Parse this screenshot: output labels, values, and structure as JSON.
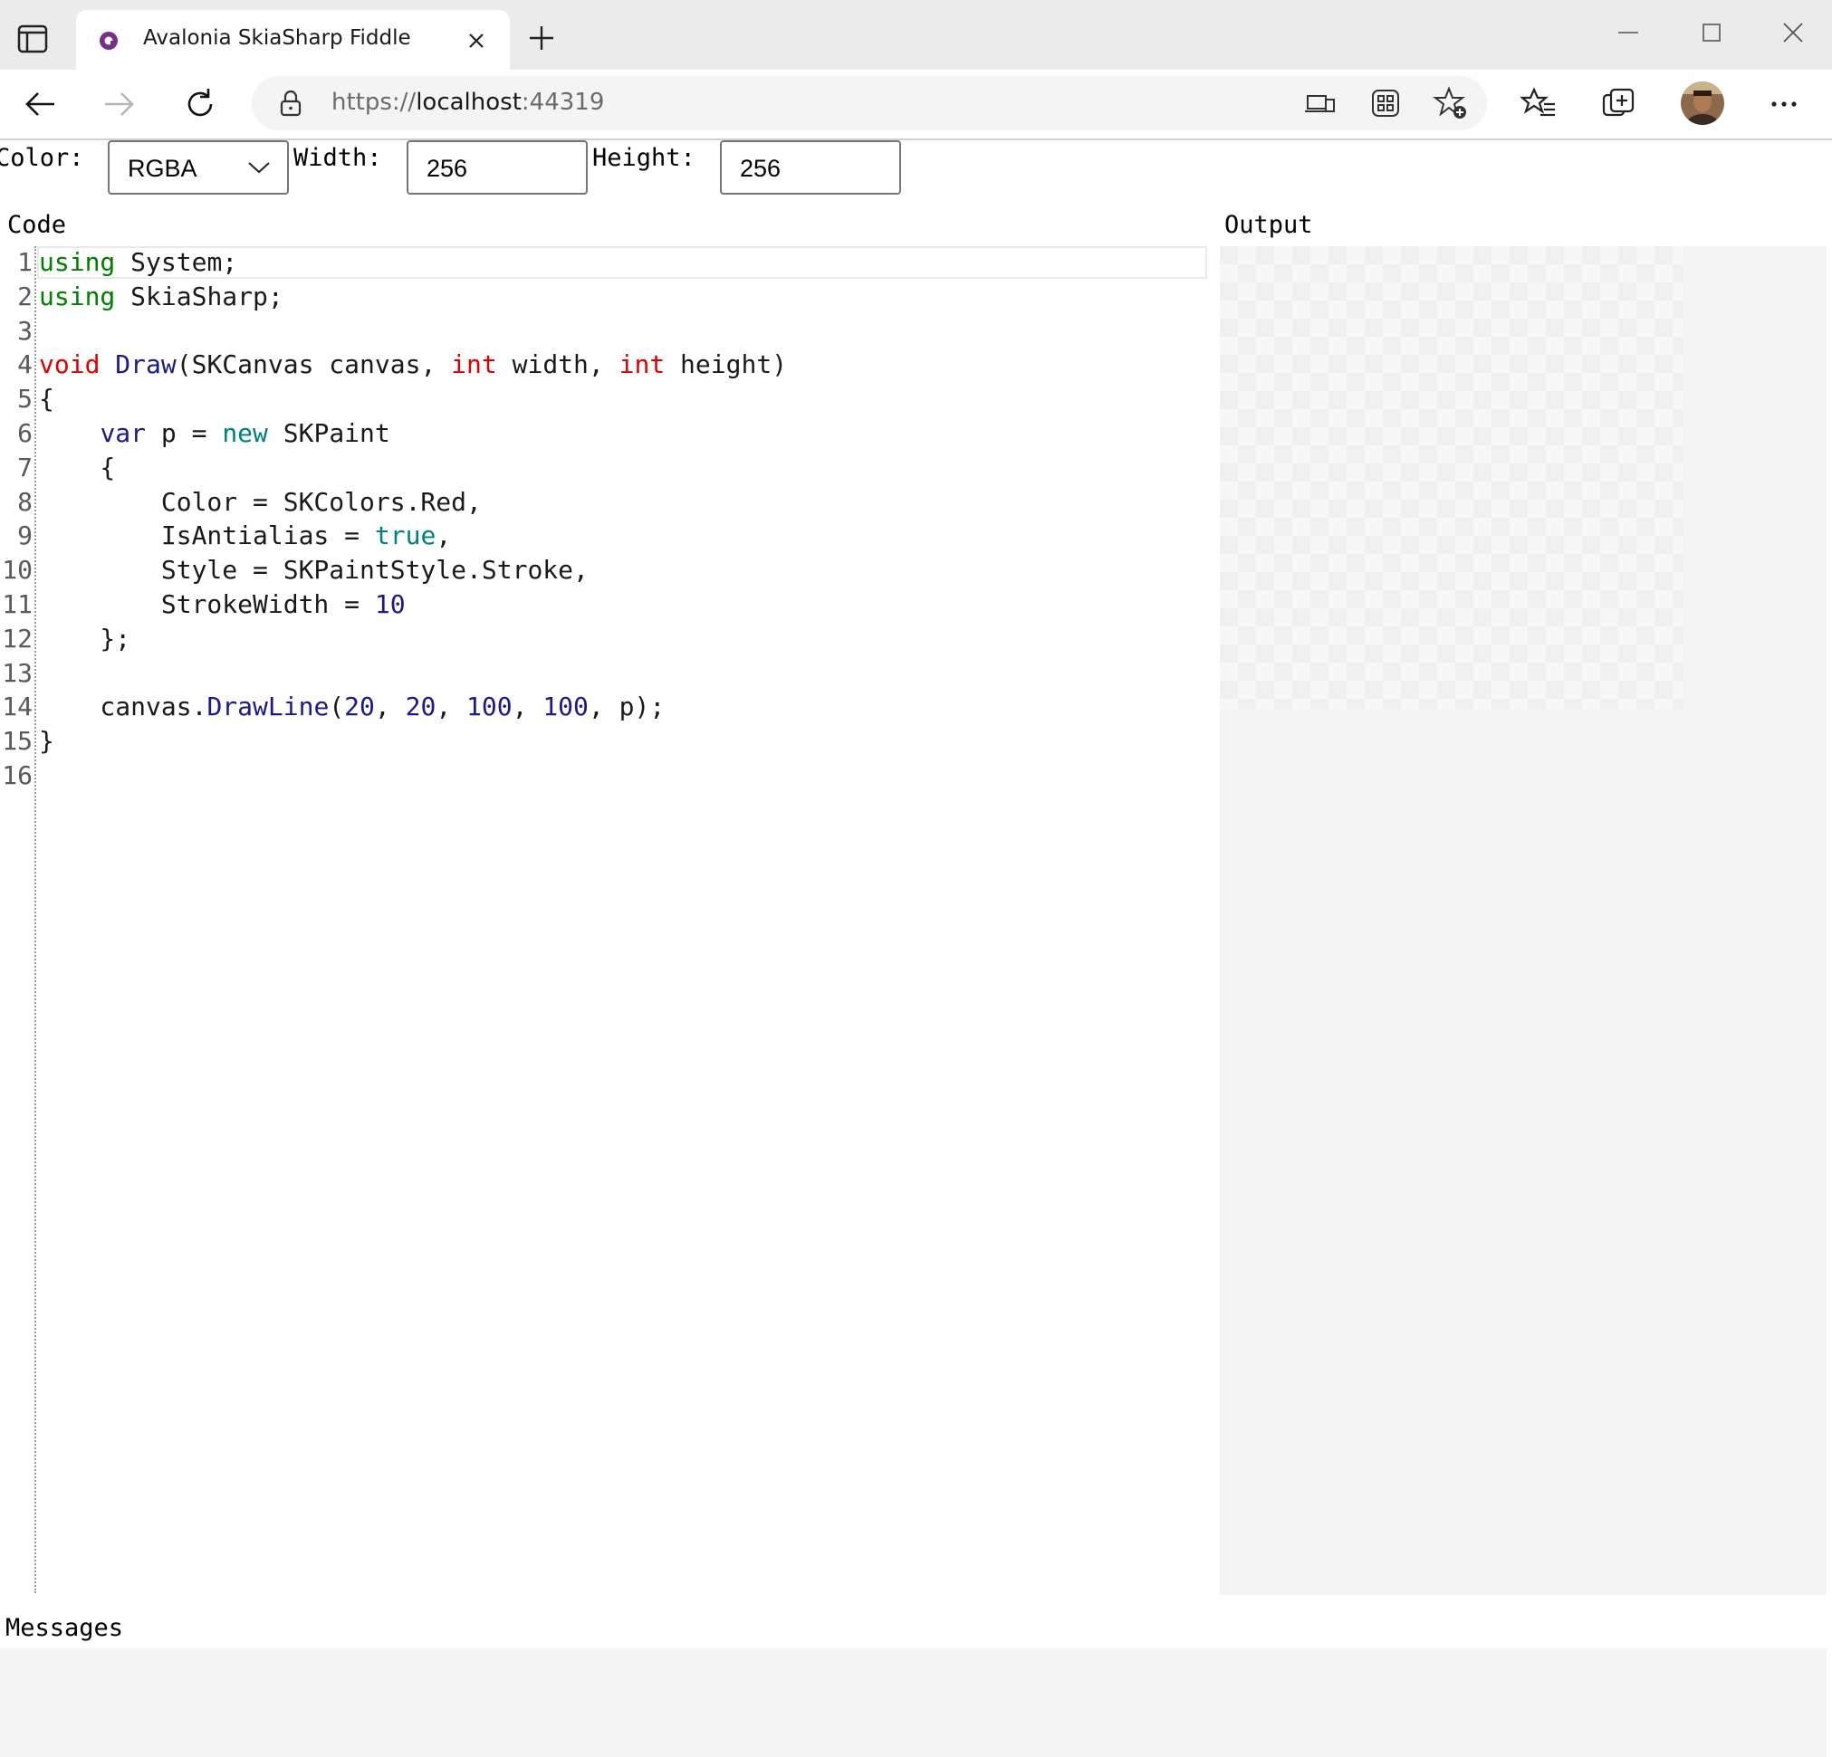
{
  "browser": {
    "tab_title": "Avalonia SkiaSharp Fiddle",
    "url_scheme": "https://",
    "url_host": "localhost",
    "url_port": ":44319",
    "accent": "#7b2d8e"
  },
  "controls": {
    "color_label": "Color:",
    "color_value": "RGBA",
    "width_label": "Width:",
    "width_value": "256",
    "height_label": "Height:",
    "height_value": "256"
  },
  "sections": {
    "code": "Code",
    "output": "Output",
    "messages": "Messages"
  },
  "code_lines": [
    {
      "n": "1",
      "tokens": [
        [
          "kw-green",
          "using"
        ],
        [
          "",
          "System;"
        ]
      ]
    },
    {
      "n": "2",
      "tokens": [
        [
          "kw-green",
          "using"
        ],
        [
          "",
          "SkiaSharp;"
        ]
      ]
    },
    {
      "n": "3",
      "tokens": []
    },
    {
      "n": "4",
      "tokens": [
        [
          "kw-red",
          "void"
        ],
        [
          "kw-blue",
          "Draw"
        ],
        [
          "",
          "(SKCanvas canvas, "
        ],
        [
          "kw-red",
          "int"
        ],
        [
          "",
          " width, "
        ],
        [
          "kw-red",
          "int"
        ],
        [
          "",
          " height)"
        ]
      ]
    },
    {
      "n": "5",
      "tokens": [
        [
          "",
          "{"
        ]
      ]
    },
    {
      "n": "6",
      "tokens": [
        [
          "",
          "    "
        ],
        [
          "kw-blue",
          "var"
        ],
        [
          "",
          " p = "
        ],
        [
          "kw-teal",
          "new"
        ],
        [
          "",
          " SKPaint"
        ]
      ]
    },
    {
      "n": "7",
      "tokens": [
        [
          "",
          "    {"
        ]
      ]
    },
    {
      "n": "8",
      "tokens": [
        [
          "",
          "        Color = SKColors.Red,"
        ]
      ]
    },
    {
      "n": "9",
      "tokens": [
        [
          "",
          "        IsAntialias = "
        ],
        [
          "kw-teal",
          "true"
        ],
        [
          "",
          ","
        ]
      ]
    },
    {
      "n": "10",
      "tokens": [
        [
          "",
          "        Style = SKPaintStyle.Stroke,"
        ]
      ]
    },
    {
      "n": "11",
      "tokens": [
        [
          "",
          "        StrokeWidth = "
        ],
        [
          "num",
          "10"
        ]
      ]
    },
    {
      "n": "12",
      "tokens": [
        [
          "",
          "    };"
        ]
      ]
    },
    {
      "n": "13",
      "tokens": []
    },
    {
      "n": "14",
      "tokens": [
        [
          "",
          "    canvas."
        ],
        [
          "kw-blue",
          "DrawLine"
        ],
        [
          "",
          "("
        ],
        [
          "num",
          "20"
        ],
        [
          "",
          ", "
        ],
        [
          "num",
          "20"
        ],
        [
          "",
          ", "
        ],
        [
          "num",
          "100"
        ],
        [
          "",
          ", "
        ],
        [
          "num",
          "100"
        ],
        [
          "",
          ", p);"
        ]
      ]
    },
    {
      "n": "15",
      "tokens": [
        [
          "",
          "}"
        ]
      ]
    },
    {
      "n": "16",
      "tokens": []
    }
  ]
}
